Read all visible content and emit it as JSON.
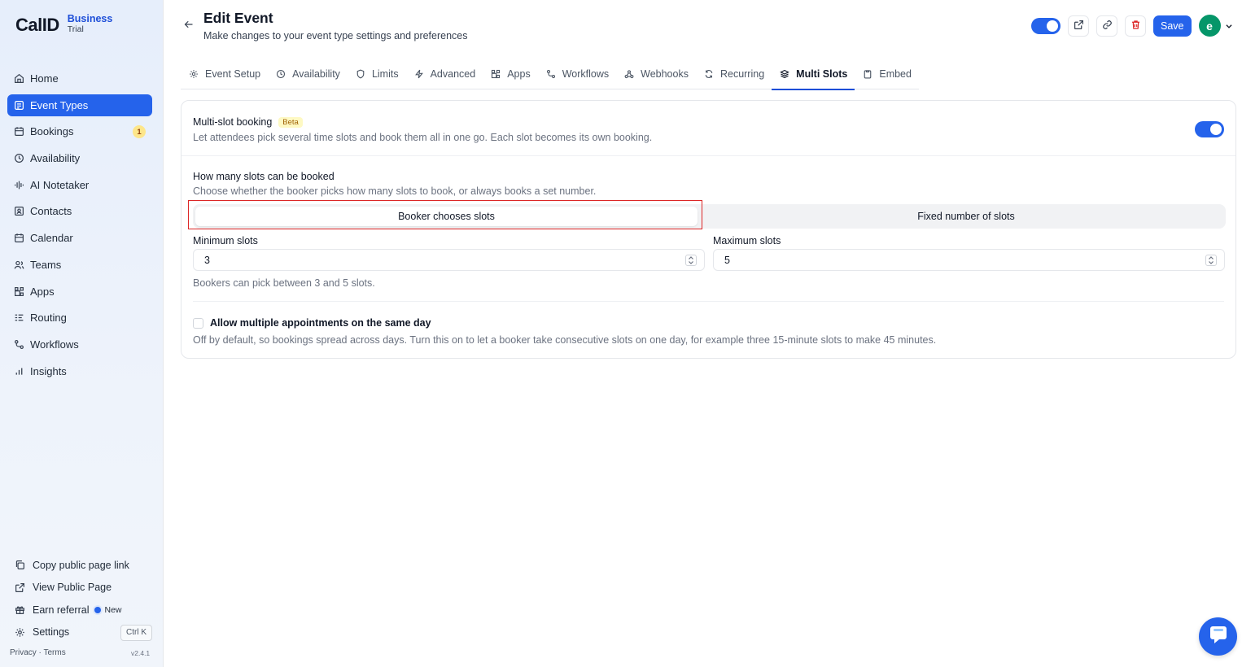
{
  "brand": {
    "logo": "CalID",
    "plan": "Business",
    "tier": "Trial"
  },
  "sidebar": {
    "items": [
      {
        "label": "Home",
        "icon": "home-icon"
      },
      {
        "label": "Event Types",
        "icon": "event-types-icon",
        "active": true
      },
      {
        "label": "Bookings",
        "icon": "calendar-icon",
        "badge": "1"
      },
      {
        "label": "Availability",
        "icon": "clock-icon"
      },
      {
        "label": "AI Notetaker",
        "icon": "waveform-icon"
      },
      {
        "label": "Contacts",
        "icon": "contacts-icon"
      },
      {
        "label": "Calendar",
        "icon": "calendar-icon"
      },
      {
        "label": "Teams",
        "icon": "users-icon"
      },
      {
        "label": "Apps",
        "icon": "apps-icon"
      },
      {
        "label": "Routing",
        "icon": "routing-icon"
      },
      {
        "label": "Workflows",
        "icon": "workflow-icon"
      },
      {
        "label": "Insights",
        "icon": "bar-chart-icon"
      }
    ],
    "bottom": {
      "copy_link": "Copy public page link",
      "view_public": "View Public Page",
      "earn_referral": "Earn referral",
      "new_label": "New",
      "settings": "Settings",
      "settings_shortcut": "Ctrl K"
    },
    "legal": "Privacy · Terms",
    "version": "v2.4.1"
  },
  "header": {
    "title": "Edit Event",
    "subtitle": "Make changes to your event type settings and preferences",
    "save_label": "Save",
    "avatar_initial": "e",
    "hidden_toggle_on": true
  },
  "tabs": [
    {
      "label": "Event Setup",
      "icon": "gear-icon"
    },
    {
      "label": "Availability",
      "icon": "clock-icon"
    },
    {
      "label": "Limits",
      "icon": "shield-icon"
    },
    {
      "label": "Advanced",
      "icon": "bolt-icon"
    },
    {
      "label": "Apps",
      "icon": "apps-icon"
    },
    {
      "label": "Workflows",
      "icon": "workflow-icon"
    },
    {
      "label": "Webhooks",
      "icon": "webhook-icon"
    },
    {
      "label": "Recurring",
      "icon": "repeat-icon"
    },
    {
      "label": "Multi Slots",
      "icon": "layers-icon",
      "active": true
    },
    {
      "label": "Embed",
      "icon": "clipboard-icon"
    }
  ],
  "multi_slot": {
    "title": "Multi-slot booking",
    "badge": "Beta",
    "description": "Let attendees pick several time slots and book them all in one go. Each slot becomes its own booking.",
    "enabled": true,
    "count_title": "How many slots can be booked",
    "count_desc": "Choose whether the booker picks how many slots to book, or always books a set number.",
    "mode_options": [
      "Booker chooses slots",
      "Fixed number of slots"
    ],
    "selected_mode": "Booker chooses slots",
    "min_label": "Minimum slots",
    "min_value": "3",
    "max_label": "Maximum slots",
    "max_value": "5",
    "range_hint": "Bookers can pick between 3 and 5 slots.",
    "same_day_label": "Allow multiple appointments on the same day",
    "same_day_checked": false,
    "same_day_desc": "Off by default, so bookings spread across days. Turn this on to let a booker take consecutive slots on one day, for example three 15-minute slots to make 45 minutes."
  },
  "colors": {
    "accent": "#2563eb",
    "highlight": "#dc2626",
    "beta_bg": "#fef9c3",
    "avatar_bg": "#059669"
  }
}
